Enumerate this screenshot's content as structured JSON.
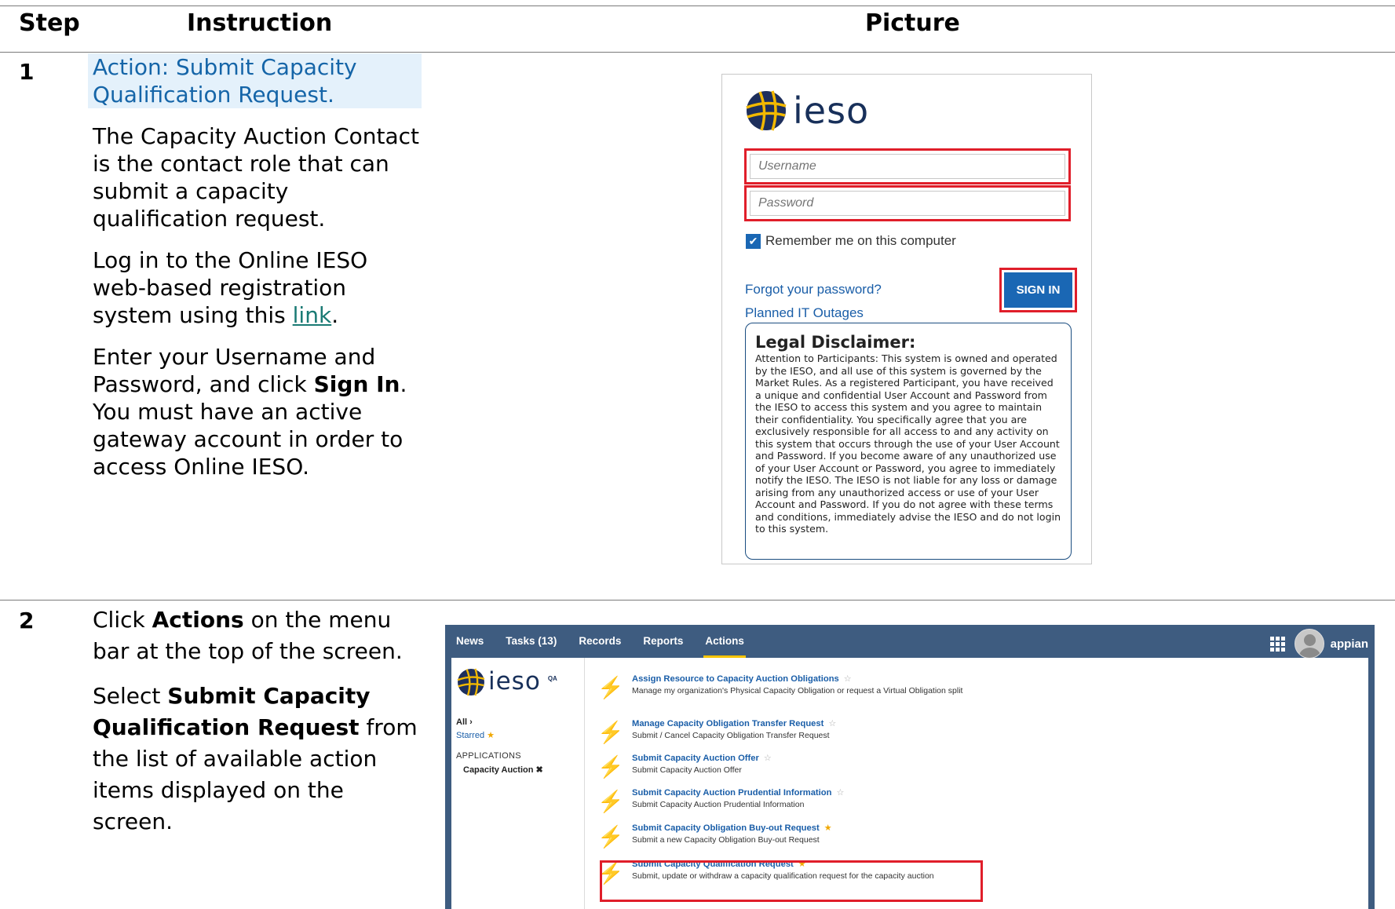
{
  "header": {
    "step": "Step",
    "instruction": "Instruction",
    "picture": "Picture"
  },
  "step1": {
    "number": "1",
    "action_heading": "Action: Submit Capacity Qualification Request.",
    "para1": "The Capacity Auction Contact is the contact role that can submit a capacity qualification request.",
    "para2_pre": "Log in to the Online IESO web-based registration system using this ",
    "para2_link": "link",
    "para2_post": ".",
    "para3_pre": "Enter your Username and Password, and click ",
    "para3_bold": "Sign In",
    "para3_post": ". You must have an active gateway account in order to access Online IESO.",
    "login": {
      "logo_text": "ieso",
      "username_placeholder": "Username",
      "password_placeholder": "Password",
      "remember_label": "Remember me on this computer",
      "remember_checked": true,
      "forgot_link": "Forgot your password?",
      "planned_link": "Planned IT Outages",
      "signin_label": "SIGN IN",
      "disclaimer_title": "Legal Disclaimer:",
      "disclaimer_body": "Attention to Participants: This system is owned and operated by the IESO, and all use of this system is governed by the Market Rules. As a registered Participant, you have received a unique and confidential User Account and Password from the IESO to access this system and you agree to maintain their confidentiality. You specifically agree that you are exclusively responsible for all access to and any activity on this system that occurs through the use of your User Account and Password. If you become aware of any unauthorized use of your User Account or Password, you agree to immediately notify the IESO. The IESO is not liable for any loss or damage arising from any unauthorized access or use of your User Account and Password. If you do not agree with these terms and conditions, immediately advise the IESO and do not login to this system."
    }
  },
  "step2": {
    "number": "2",
    "para1_pre": "Click ",
    "para1_bold": "Actions",
    "para1_post": " on the menu bar at the top of the screen.",
    "para2_pre": "Select ",
    "para2_bold": "Submit Capacity Qualification Request",
    "para2_post": " from the list of available action items displayed on the screen.",
    "appian": {
      "nav": [
        "News",
        "Tasks (13)",
        "Records",
        "Reports",
        "Actions"
      ],
      "active_nav": "Actions",
      "brand": "appian",
      "sidebar": {
        "logo_text": "ieso",
        "qa": "QA",
        "all": "All ›",
        "starred": "Starred",
        "applications": "APPLICATIONS",
        "capacity_auction": "Capacity Auction ✖"
      },
      "actions": [
        {
          "title": "Assign Resource to Capacity Auction Obligations",
          "desc": "Manage my organization's Physical Capacity Obligation or request a Virtual Obligation split",
          "starred": false
        },
        {
          "title": "Manage Capacity Obligation Transfer Request",
          "desc": "Submit / Cancel Capacity Obligation Transfer Request",
          "starred": false
        },
        {
          "title": "Submit Capacity Auction Offer",
          "desc": "Submit Capacity Auction Offer",
          "starred": false
        },
        {
          "title": "Submit Capacity Auction Prudential Information",
          "desc": "Submit Capacity Auction Prudential Information",
          "starred": false
        },
        {
          "title": "Submit Capacity Obligation Buy-out Request",
          "desc": "Submit a new Capacity Obligation Buy-out Request",
          "starred": true
        },
        {
          "title": "Submit Capacity Qualification Request",
          "desc": "Submit, update or withdraw a capacity qualification request for the capacity auction",
          "starred": true
        }
      ]
    }
  },
  "colors": {
    "highlight_red": "#e01e2a",
    "link_blue": "#1a5ea8",
    "nav_bg": "#3e5c80",
    "bolt": "#f5a300",
    "action_heading_bg": "#e4f1fb"
  }
}
